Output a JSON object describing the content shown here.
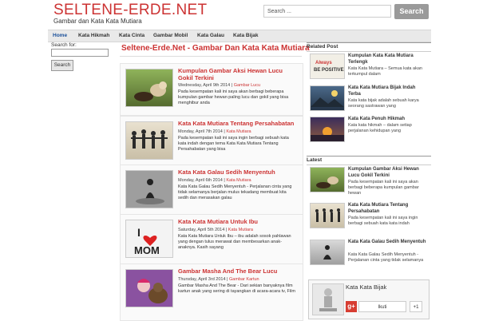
{
  "site": {
    "title": "SELTENE-ERDE.NET",
    "description": "Gambar dan Kata Kata Mutiara"
  },
  "search": {
    "placeholder": "Search ...",
    "button": "Search"
  },
  "nav": {
    "items": [
      "Home",
      "Kata Hikmah",
      "Kata Cinta",
      "Gambar Mobil",
      "Kata Galau",
      "Kata Bijak"
    ]
  },
  "left_sidebar": {
    "search_label": "Search for:",
    "search_button": "Search"
  },
  "main": {
    "title": "Seltene-Erde.Net - Gambar Dan Kata Kata Mutiara",
    "posts": [
      {
        "title": "Kumpulan Gambar Aksi Hewan Lucu Gokil Terkini",
        "meta_date": "Wednesday, April 9th 2014 |",
        "meta_cat": "Gambar Lucu",
        "excerpt": "Pada kesempatan kali ini saya akan berbagi beberapa kumpulan gambar hewan paling lucu dan gokil yang bisa menghibur anda"
      },
      {
        "title": "Kata Kata Mutiara Tentang Persahabatan",
        "meta_date": "Monday, April 7th 2014 |",
        "meta_cat": "Kata Mutiara",
        "excerpt": "Pada kesempatan kali ini saya ingin berbagi sebuah kata kata indah dengan tema Kata Kata Mutiara Tentang Persahabatan yang bisa"
      },
      {
        "title": "Kata Kata Galau Sedih Menyentuh",
        "meta_date": "Monday, April 6th 2014 |",
        "meta_cat": "Kata Mutiara",
        "excerpt": "Kata Kata Galau Sedih Menyentuh - Perjalanan cinta yang tidak selamanya berjalan mulus tekadang membuat kita sedih dan merasakan galau"
      },
      {
        "title": "Kata Kata Mutiara Untuk Ibu",
        "meta_date": "Saturday, April 5th 2014 |",
        "meta_cat": "Kata Mutiara",
        "excerpt": "Kata Kata Mutiara Untuk Ibu – ibu adalah sosok pahlawan yang dengan tulus merawat dan membesarkan anak-anaknya. Kasih sayang"
      },
      {
        "title": "Gambar Masha And The Bear Lucu",
        "meta_date": "Thursday, April 3rd 2014 |",
        "meta_cat": "Gambar Kartun",
        "excerpt": "Gambar Masha And The Bear - Dari sekian banyaknya film kartun anak yang sering di tayangkan di acara-acara tv, Film"
      }
    ]
  },
  "right": {
    "related_heading": "Related Post",
    "related": [
      {
        "title": "Kumpulan Kata Kata Mutiara Terlengk",
        "excerpt": "Kata Kata Mutiara – Semua kata akan terkumpul dalam"
      },
      {
        "title": "Kata Kata Mutiara Bijak Indah Terba",
        "excerpt": "Kata kata bijak adalah sebuah karya seorang sastrawan yang"
      },
      {
        "title": "Kata Kata Penuh Hikmah",
        "excerpt": "Kata kata hikmah – dalam setiap perjalanan kehidupan yang"
      }
    ],
    "latest_heading": "Latest",
    "latest": [
      {
        "title": "Kumpulan Gambar Aksi Hewan Lucu Gokil Terkini",
        "excerpt": "Pada kesempatan kali ini saya akan berbagi beberapa kumpulan gambar hewan"
      },
      {
        "title": "Kata Kata Mutiara Tentang Persahabatan",
        "excerpt": "Pada kesempatan kali ini saya ingin berbagi sebuah kata kata indah"
      },
      {
        "title": "Kata Kata Galau Sedih Menyentuh",
        "excerpt": "Kata Kata Galau Sedih Menyentuh - Perjalanan cinta yang tidak selamanya"
      }
    ],
    "gplus_name": "Kata Kata Bijak",
    "gplus_follow": "Ikuti",
    "gplus_plusone": "+1"
  },
  "thumbs": {
    "related_1_text": "Always BE POSITIVE!",
    "post_4_text": "I MOM"
  },
  "colors": {
    "accent": "#cc3333",
    "nav_active": "#1a4f9a"
  }
}
